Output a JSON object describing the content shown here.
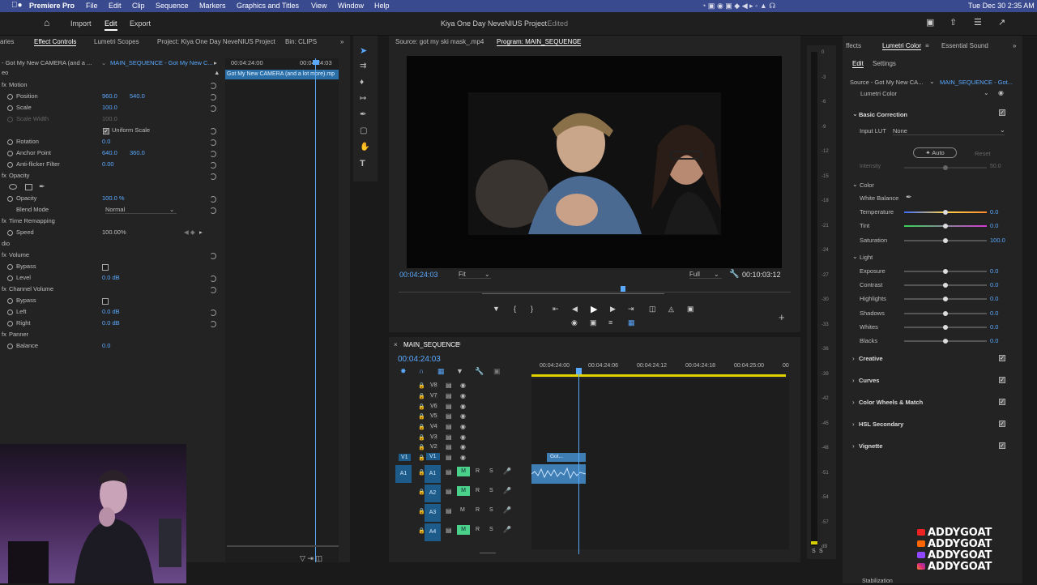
{
  "menubar": {
    "apple": "",
    "items": [
      "Premiere Pro",
      "File",
      "Edit",
      "Clip",
      "Sequence",
      "Markers",
      "Graphics and Titles",
      "View",
      "Window",
      "Help"
    ],
    "clock": "Tue Dec 30  2:35 AM"
  },
  "appbar": {
    "workspaces": [
      "Import",
      "Edit",
      "Export"
    ],
    "active_workspace": "Edit",
    "project_title": "Kiya One Day NeveNIUS Project",
    "edited_label": "- Edited"
  },
  "left_tabs": [
    "aries",
    "Effect Controls",
    "Lumetri Scopes",
    "Project: Kiya One Day NeveNIUS Project",
    "Bin: CLIPS"
  ],
  "effect_controls": {
    "source_label": "- Got My New CAMERA (and a ...",
    "sequence_label": "MAIN_SEQUENCE - Got My New C...",
    "time_start": "00:04:24:00",
    "time_end": "00:04:24:03",
    "clip_name": "Got My New CAMERA (and a lot more).mp",
    "video_header": "eo",
    "motion": "Motion",
    "position_label": "Position",
    "position_x": "960.0",
    "position_y": "540.0",
    "scale_label": "Scale",
    "scale_value": "100.0",
    "scale_width_label": "Scale Width",
    "scale_width_value": "100.0",
    "uniform_scale": "Uniform Scale",
    "rotation_label": "Rotation",
    "rotation_value": "0.0",
    "anchor_label": "Anchor Point",
    "anchor_x": "640.0",
    "anchor_y": "360.0",
    "antiflicker_label": "Anti-flicker Filter",
    "antiflicker_value": "0.00",
    "opacity_header": "Opacity",
    "opacity_label": "Opacity",
    "opacity_value": "100.0 %",
    "blend_label": "Blend Mode",
    "blend_value": "Normal",
    "time_remap": "Time Remapping",
    "speed_label": "Speed",
    "speed_value": "100.00%",
    "audio_header": "dio",
    "volume_header": "Volume",
    "bypass_label": "Bypass",
    "level_label": "Level",
    "level_value": "0.0 dB",
    "channel_volume": "Channel Volume",
    "bypass2_label": "Bypass",
    "left_label": "Left",
    "left_value": "0.0 dB",
    "right_label": "Right",
    "right_value": "0.0 dB",
    "panner_header": "Panner",
    "balance_label": "Balance",
    "balance_value": "0.0"
  },
  "monitor": {
    "source_tab": "Source: got my ski mask_.mp4",
    "program_tab": "Program: MAIN_SEQUENCE",
    "timecode_left": "00:04:24:03",
    "fit": "Fit",
    "quality": "Full",
    "timecode_right": "00:10:03:12"
  },
  "timeline": {
    "sequence_name": "MAIN_SEQUENCE",
    "timecode": "00:04:24:03",
    "ruler": [
      "00:04:24:00",
      "00:04:24:06",
      "00:04:24:12",
      "00:04:24:18",
      "00:04:25:00",
      "00"
    ],
    "video_tracks": [
      "V8",
      "V7",
      "V6",
      "V5",
      "V4",
      "V3",
      "V2",
      "V1"
    ],
    "audio_tracks": [
      "A1",
      "A2",
      "A3",
      "A4"
    ],
    "source_v": "V1",
    "source_a": "A1",
    "clip_label": "Got..."
  },
  "meters": [
    "0",
    "-3",
    "-6",
    "-9",
    "-12",
    "-15",
    "-18",
    "-21",
    "-24",
    "-27",
    "-30",
    "-33",
    "-36",
    "-39",
    "-42",
    "-45",
    "-48",
    "-51",
    "-54",
    "-57",
    "dB"
  ],
  "meter_solo": [
    "S",
    "S"
  ],
  "lumetri": {
    "tabs": [
      "ffects",
      "Lumetri Color",
      "Essential Sound"
    ],
    "subtabs": [
      "Edit",
      "Settings"
    ],
    "source_label": "Source - Got My New CA...",
    "sequence_label": "MAIN_SEQUENCE - Got...",
    "effect_name": "Lumetri Color",
    "basic_correction": "Basic Correction",
    "input_lut_label": "Input LUT",
    "input_lut_value": "None",
    "auto_label": "Auto",
    "reset_label": "Reset",
    "intensity_label": "Intensity",
    "intensity_value": "50.0",
    "color_header": "Color",
    "white_balance": "White Balance",
    "temperature_label": "Temperature",
    "temperature_value": "0.0",
    "tint_label": "Tint",
    "tint_value": "0.0",
    "saturation_label": "Saturation",
    "saturation_value": "100.0",
    "light_header": "Light",
    "light_rows": [
      {
        "label": "Exposure",
        "value": "0.0"
      },
      {
        "label": "Contrast",
        "value": "0.0"
      },
      {
        "label": "Highlights",
        "value": "0.0"
      },
      {
        "label": "Shadows",
        "value": "0.0"
      },
      {
        "label": "Whites",
        "value": "0.0"
      },
      {
        "label": "Blacks",
        "value": "0.0"
      }
    ],
    "sections": [
      "Creative",
      "Curves",
      "Color Wheels & Match",
      "HSL Secondary",
      "Vignette"
    ],
    "bottom_label": "Stabilization"
  },
  "watermark": [
    "ADDYGOAT",
    "ADDYGOAT",
    "ADDYGOAT",
    "ADDYGOAT"
  ],
  "colors": {
    "accent": "#5aa9ff",
    "menubar": "#3a4a8f",
    "track_on": "#4ad28a",
    "source_patch": "#1d5c8a"
  }
}
